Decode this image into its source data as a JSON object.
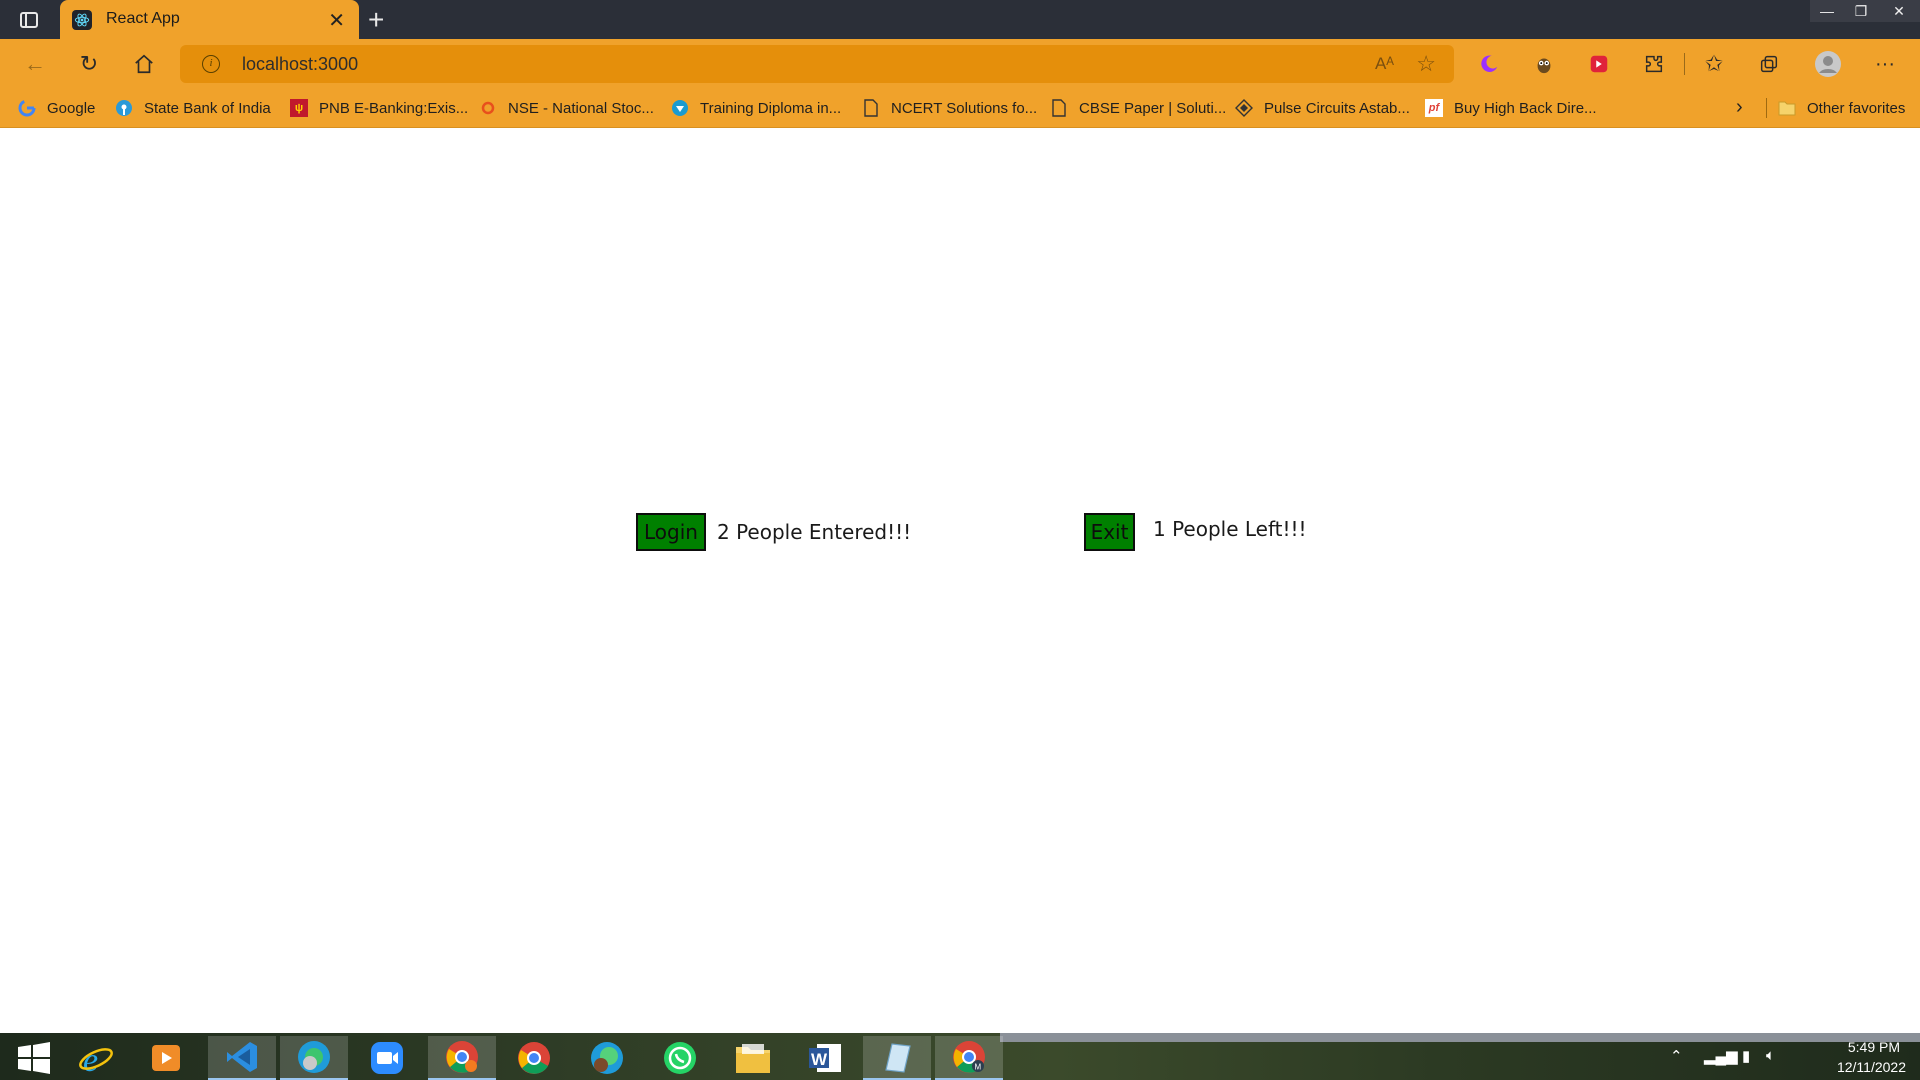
{
  "browser": {
    "tab_title": "React App",
    "new_tab_symbol": "+",
    "url": "localhost:3000",
    "window_controls": {
      "minimize": "—",
      "restore": "❐",
      "close": "✕"
    }
  },
  "toolbar_icons": [
    "back-icon",
    "refresh-icon",
    "home-icon",
    "read-aloud-icon",
    "favorite-star-icon",
    "moon-extension-icon",
    "owl-extension-icon",
    "media-extension-icon",
    "extensions-icon",
    "favorites-icon",
    "collections-icon",
    "profile-icon",
    "more-icon"
  ],
  "bookmarks": [
    {
      "label": "Google",
      "icon": "google-icon",
      "color": "#4285f4"
    },
    {
      "label": "State Bank of India",
      "icon": "sbi-icon",
      "color": "#2a9ad8"
    },
    {
      "label": "PNB E-Banking:Exis...",
      "icon": "pnb-icon",
      "color": "#c0182c"
    },
    {
      "label": "NSE - National Stoc...",
      "icon": "nse-icon",
      "color": "#e8501c"
    },
    {
      "label": "Training Diploma in...",
      "icon": "training-icon",
      "color": "#1b9bd0"
    },
    {
      "label": "NCERT Solutions fo...",
      "icon": "document-icon",
      "color": "#333333"
    },
    {
      "label": "CBSE Paper | Soluti...",
      "icon": "document-icon",
      "color": "#333333"
    },
    {
      "label": "Pulse Circuits Astab...",
      "icon": "diamond-icon",
      "color": "#333333"
    },
    {
      "label": "Buy High Back Dire...",
      "icon": "pf-icon",
      "color": "#e0433a"
    }
  ],
  "other_favorites": "Other favorites",
  "app": {
    "login_button": "Login",
    "entered_text": "2 People Entered!!!",
    "exit_button": "Exit",
    "left_text": "1 People Left!!!",
    "button_color": "#008000"
  },
  "taskbar": {
    "apps": [
      "windows-start-icon",
      "internet-explorer-icon",
      "media-player-icon",
      "vscode-icon",
      "edge-profile-icon",
      "zoom-icon",
      "chrome-icon",
      "chrome-icon",
      "edge-dev-icon",
      "whatsapp-icon",
      "file-explorer-icon",
      "word-icon",
      "notepad-icon",
      "chrome-profile-icon"
    ],
    "time": "5:49 PM",
    "date": "12/11/2022"
  }
}
